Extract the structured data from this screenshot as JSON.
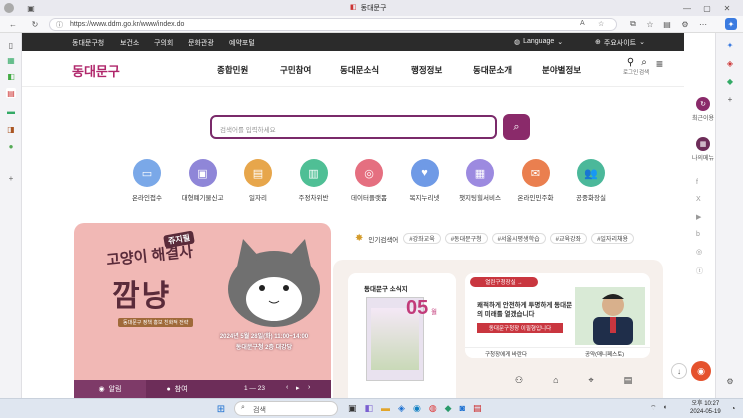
{
  "browser": {
    "tab_title": "동대문구",
    "url": "https://www.ddm.go.kr/www/index.do"
  },
  "top_nav": {
    "links": [
      "동대문구청",
      "보건소",
      "구의회",
      "문화관광",
      "예약포털"
    ],
    "language_label": "Language",
    "major_sites_label": "주요사이트"
  },
  "header": {
    "logo_text": "동대문구",
    "menu": [
      "종합민원",
      "구민참여",
      "동대문소식",
      "행정정보",
      "동대문소개",
      "분야별정보"
    ],
    "login_label": "로그인",
    "search_label": "검색"
  },
  "search": {
    "placeholder": "검색어를 입력하세요"
  },
  "quick_links": [
    {
      "label": "온라인접수",
      "color": "#7aa8e8",
      "icon": "▭"
    },
    {
      "label": "대형폐기물신고",
      "color": "#8f86d8",
      "icon": "▣"
    },
    {
      "label": "일자리",
      "color": "#e7a64b",
      "icon": "▤"
    },
    {
      "label": "주정차위반",
      "color": "#4fbf95",
      "icon": "▥"
    },
    {
      "label": "데이터플랫폼",
      "color": "#e56f80",
      "icon": "◎"
    },
    {
      "label": "복지누리넷",
      "color": "#6f9ae6",
      "icon": "♥"
    },
    {
      "label": "챗지팅힐서비스",
      "color": "#9c8ae0",
      "icon": "▦"
    },
    {
      "label": "온라인민주화",
      "color": "#ea7f4f",
      "icon": "✉"
    },
    {
      "label": "공중화장실",
      "color": "#4bb89a",
      "icon": "👥"
    }
  ],
  "popular": {
    "label": "인기검색어",
    "tags": [
      "#강좌교육",
      "#동대문구청",
      "#서울시평생학습",
      "#교육강좌",
      "#일자리채용"
    ]
  },
  "banner": {
    "line1": "쥬지필",
    "line2": "고양이 해결사",
    "line3": "깜냥",
    "subtitle": "동대문구 정책 홍보 친화적 전략",
    "date_text": "2024년 5월 28일(화) 11:00~14:00",
    "place_text": "동대문구청 2층 대강당",
    "tab_notice": "알림",
    "tab_join": "참여",
    "pager": "1 — 23"
  },
  "news_card": {
    "title": "동대문구 소식지",
    "issue": "05",
    "issue_suffix": "월"
  },
  "mayor_card": {
    "title": "열린구청장실 →",
    "text": "쾌적하게 안전하게 투명하게 동대문의 미래를 열겠습니다",
    "button": "동대문구청장 이필형입니다",
    "link1": "구청장에게 바란다",
    "link2": "공약(매니페스토)"
  },
  "right_panel": {
    "recent_label": "최근이용",
    "mymenu_label": "나의메뉴",
    "social": [
      "f",
      "X",
      "▶",
      "b",
      "◎",
      "ⓣ"
    ]
  },
  "taskbar": {
    "search_placeholder": "검색",
    "time": "오후 10:27",
    "date": "2024-05-19"
  },
  "colors": {
    "brand": "#8a2a6a",
    "search_border": "#7a2a6a",
    "banner_bg": "#f1b8b5",
    "footer_tab_bg": "#6d2d59"
  }
}
